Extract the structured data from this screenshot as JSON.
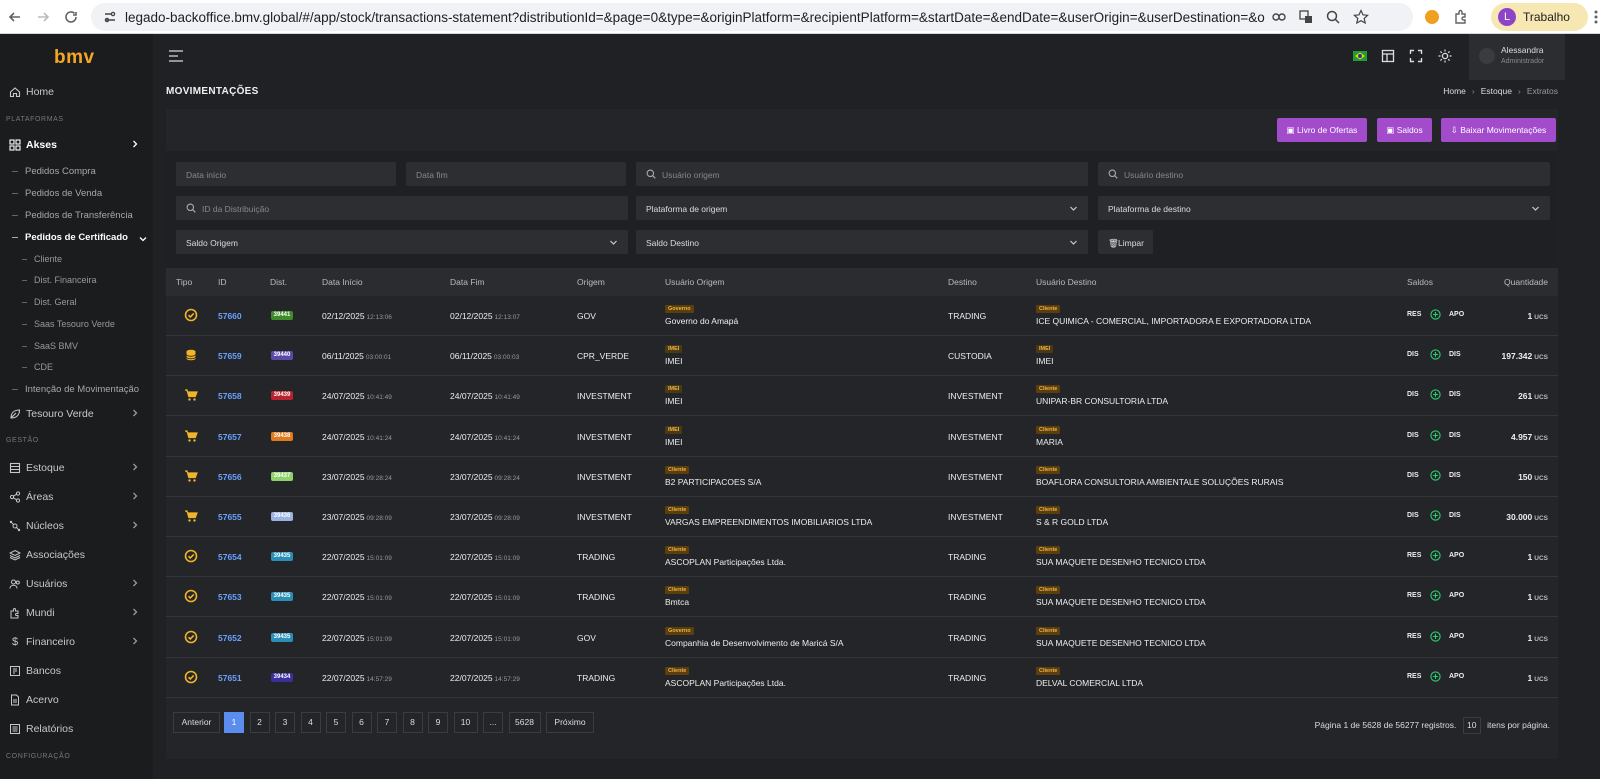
{
  "browser": {
    "url": "legado-backoffice.bmv.global/#/app/stock/transactions-statement?distributionId=&page=0&type=&originPlatform=&recipientPlatform=&startDate=&endDate=&userOrigin=&userDestination=&originBalance=&targetBa...",
    "profile_initial": "L",
    "profile_name": "Trabalho"
  },
  "sidebar": {
    "logo": "bmv",
    "home": "Home",
    "section_platforms": "PLATAFORMAS",
    "akses": "Akses",
    "akses_items": [
      "Pedidos Compra",
      "Pedidos de Venda",
      "Pedidos de Transferência",
      "Pedidos de Certificado"
    ],
    "cert_items": [
      "Cliente",
      "Dist. Financeira",
      "Dist. Geral",
      "Saas Tesouro Verde",
      "SaaS BMV",
      "CDE"
    ],
    "intent": "Intenção de Movimentação",
    "tesouro": "Tesouro Verde",
    "section_management": "GESTÃO",
    "management": [
      "Estoque",
      "Áreas",
      "Núcleos",
      "Associações",
      "Usuários",
      "Mundi",
      "Financeiro",
      "Bancos",
      "Acervo",
      "Relatórios"
    ],
    "section_config": "CONFIGURAÇÃO"
  },
  "topbar": {
    "user_name": "Alessandra",
    "user_role": "Administrador"
  },
  "page": {
    "title": "MOVIMENTAÇÕES",
    "breadcrumb": [
      "Home",
      "Estoque",
      "Extratos"
    ]
  },
  "actions": {
    "offers": "Livro de Ofertas",
    "balances": "Saldos",
    "download": "Baixar Movimentações"
  },
  "filters": {
    "start_date": "Data início",
    "end_date": "Data fim",
    "user_origin": "Usuário origem",
    "user_destination": "Usuário destino",
    "distribution_id": "ID da Distribuição",
    "origin_platform": "Plataforma de origem",
    "destination_platform": "Plataforma de destino",
    "origin_balance": "Saldo Origem",
    "destination_balance": "Saldo Destino",
    "clear": "Limpar"
  },
  "table": {
    "headers": {
      "tipo": "Tipo",
      "id": "ID",
      "dist": "Dist.",
      "start": "Data Início",
      "end": "Data Fim",
      "origin": "Origem",
      "user_origin": "Usuário Origem",
      "destination": "Destino",
      "user_destination": "Usuário Destino",
      "balances": "Saldos",
      "quantity": "Quantidade"
    },
    "rows": [
      {
        "type": "gauge",
        "id": "57660",
        "dist": "39441",
        "dist_color": "#3f8a2b",
        "start_date": "02/12/2025",
        "start_time": "12:13:06",
        "end_date": "02/12/2025",
        "end_time": "12:13:07",
        "origin": "GOV",
        "ou_badge": "Governo",
        "ou_name": "Governo do Amapá",
        "destination": "TRADING",
        "du_badge": "Cliente",
        "du_name": "ICE QUIMICA - COMERCIAL, IMPORTADORA E EXPORTADORA LTDA",
        "from": "RES",
        "to": "APO",
        "qty": "1",
        "unit": "UCS"
      },
      {
        "type": "coins",
        "id": "57659",
        "dist": "39440",
        "dist_color": "#5b4aa8",
        "start_date": "06/11/2025",
        "start_time": "03:00:01",
        "end_date": "06/11/2025",
        "end_time": "03:00:03",
        "origin": "CPR_VERDE",
        "ou_badge": "IMEI",
        "ou_name": "IMEI",
        "destination": "CUSTODIA",
        "du_badge": "IMEI",
        "du_name": "IMEI",
        "from": "DIS",
        "to": "DIS",
        "qty": "197.342",
        "unit": "UCS"
      },
      {
        "type": "cart",
        "id": "57658",
        "dist": "39439",
        "dist_color": "#b8232f",
        "start_date": "24/07/2025",
        "start_time": "10:41:49",
        "end_date": "24/07/2025",
        "end_time": "10:41:49",
        "origin": "INVESTMENT",
        "ou_badge": "IMEI",
        "ou_name": "IMEI",
        "destination": "INVESTMENT",
        "du_badge": "Cliente",
        "du_name": "UNIPAR-BR CONSULTORIA LTDA",
        "from": "DIS",
        "to": "DIS",
        "qty": "261",
        "unit": "UCS"
      },
      {
        "type": "cart",
        "id": "57657",
        "dist": "39438",
        "dist_color": "#e07a1f",
        "start_date": "24/07/2025",
        "start_time": "10:41:24",
        "end_date": "24/07/2025",
        "end_time": "10:41:24",
        "origin": "INVESTMENT",
        "ou_badge": "IMEI",
        "ou_name": "IMEI",
        "destination": "INVESTMENT",
        "du_badge": "Cliente",
        "du_name": "MARIA",
        "from": "DIS",
        "to": "DIS",
        "qty": "4.957",
        "unit": "UCS"
      },
      {
        "type": "cart",
        "id": "57656",
        "dist": "39437",
        "dist_color": "#8fd16a",
        "start_date": "23/07/2025",
        "start_time": "09:28:24",
        "end_date": "23/07/2025",
        "end_time": "09:28:24",
        "origin": "INVESTMENT",
        "ou_badge": "Cliente",
        "ou_name": "B2 PARTICIPACOES S/A",
        "destination": "INVESTMENT",
        "du_badge": "Cliente",
        "du_name": "BOAFLORA CONSULTORIA AMBIENTALE SOLUÇÕES RURAIS",
        "from": "DIS",
        "to": "DIS",
        "qty": "150",
        "unit": "UCS"
      },
      {
        "type": "cart",
        "id": "57655",
        "dist": "39436",
        "dist_color": "#9bb3e0",
        "start_date": "23/07/2025",
        "start_time": "09:28:09",
        "end_date": "23/07/2025",
        "end_time": "09:28:09",
        "origin": "INVESTMENT",
        "ou_badge": "Cliente",
        "ou_name": "VARGAS EMPREENDIMENTOS IMOBILIARIOS LTDA",
        "destination": "INVESTMENT",
        "du_badge": "Cliente",
        "du_name": "S & R GOLD LTDA",
        "from": "DIS",
        "to": "DIS",
        "qty": "30.000",
        "unit": "UCS"
      },
      {
        "type": "gauge",
        "id": "57654",
        "dist": "39435",
        "dist_color": "#2a8fb8",
        "start_date": "22/07/2025",
        "start_time": "15:01:09",
        "end_date": "22/07/2025",
        "end_time": "15:01:09",
        "origin": "TRADING",
        "ou_badge": "Cliente",
        "ou_name": "ASCOPLAN Participações Ltda.",
        "destination": "TRADING",
        "du_badge": "Cliente",
        "du_name": "SUA MAQUETE DESENHO TECNICO LTDA",
        "from": "RES",
        "to": "APO",
        "qty": "1",
        "unit": "UCS"
      },
      {
        "type": "gauge",
        "id": "57653",
        "dist": "39435",
        "dist_color": "#2a8fb8",
        "start_date": "22/07/2025",
        "start_time": "15:01:09",
        "end_date": "22/07/2025",
        "end_time": "15:01:09",
        "origin": "TRADING",
        "ou_badge": "Cliente",
        "ou_name": "Bmtca",
        "destination": "TRADING",
        "du_badge": "Cliente",
        "du_name": "SUA MAQUETE DESENHO TECNICO LTDA",
        "from": "RES",
        "to": "APO",
        "qty": "1",
        "unit": "UCS"
      },
      {
        "type": "gauge",
        "id": "57652",
        "dist": "39435",
        "dist_color": "#2a8fb8",
        "start_date": "22/07/2025",
        "start_time": "15:01:09",
        "end_date": "22/07/2025",
        "end_time": "15:01:09",
        "origin": "GOV",
        "ou_badge": "Governo",
        "ou_name": "Companhia de Desenvolvimento de Maricá S/A",
        "destination": "TRADING",
        "du_badge": "Cliente",
        "du_name": "SUA MAQUETE DESENHO TECNICO LTDA",
        "from": "RES",
        "to": "APO",
        "qty": "1",
        "unit": "UCS"
      },
      {
        "type": "gauge",
        "id": "57651",
        "dist": "39434",
        "dist_color": "#3a2f9c",
        "start_date": "22/07/2025",
        "start_time": "14:57:29",
        "end_date": "22/07/2025",
        "end_time": "14:57:29",
        "origin": "TRADING",
        "ou_badge": "Cliente",
        "ou_name": "ASCOPLAN Participações Ltda.",
        "destination": "TRADING",
        "du_badge": "Cliente",
        "du_name": "DELVAL COMERCIAL LTDA",
        "from": "RES",
        "to": "APO",
        "qty": "1",
        "unit": "UCS"
      }
    ]
  },
  "pagination": {
    "prev": "Anterior",
    "pages": [
      "1",
      "2",
      "3",
      "4",
      "5",
      "6",
      "7",
      "8",
      "9",
      "10",
      "...",
      "5628"
    ],
    "next": "Próximo",
    "info": "Página 1 de 5628 de 56277 registros.",
    "page_size": "10",
    "per_page": "itens por página."
  },
  "colors": {
    "accent": "#a24ccc",
    "logo": "#f5a623",
    "link": "#6aa1ff",
    "active_page": "#5b8def",
    "badge_governo": "#5a3e0e",
    "badge_cliente": "#5a3e0e",
    "badge_text": "#f0b24a",
    "badge_imei": "#4a3a12",
    "icon_gold": "#f0b429",
    "plus": "#2ecc71"
  }
}
